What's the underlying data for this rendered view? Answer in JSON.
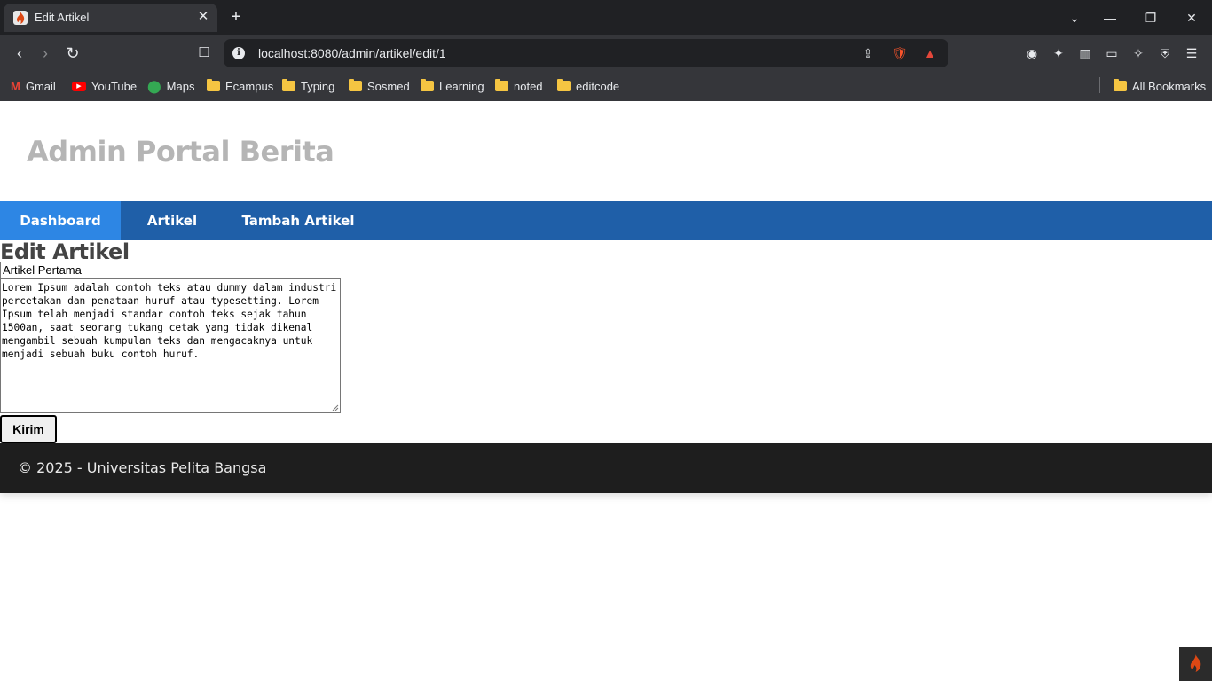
{
  "browser": {
    "tab_title": "Edit Artikel",
    "url": "localhost:8080/admin/artikel/edit/1",
    "bookmarks": [
      {
        "label": "Gmail",
        "icon": "gmail-icon"
      },
      {
        "label": "YouTube",
        "icon": "youtube-icon"
      },
      {
        "label": "Maps",
        "icon": "maps-icon"
      },
      {
        "label": "Ecampus",
        "icon": "folder-icon"
      },
      {
        "label": "Typing",
        "icon": "folder-icon"
      },
      {
        "label": "Sosmed",
        "icon": "folder-icon"
      },
      {
        "label": "Learning",
        "icon": "folder-icon"
      },
      {
        "label": "noted",
        "icon": "folder-icon"
      },
      {
        "label": "editcode",
        "icon": "folder-icon"
      }
    ],
    "all_bookmarks": "All Bookmarks"
  },
  "site": {
    "title": "Admin Portal Berita",
    "nav": [
      {
        "label": "Dashboard",
        "active": true
      },
      {
        "label": "Artikel",
        "active": false
      },
      {
        "label": "Tambah Artikel",
        "active": false
      }
    ],
    "colors": {
      "nav": "#1f5fa8",
      "nav_active": "#2d86e4",
      "footer": "#1e1e1e"
    }
  },
  "form": {
    "heading": "Edit Artikel",
    "title_value": "Artikel Pertama",
    "content_value": "Lorem Ipsum adalah contoh teks atau dummy dalam industri percetakan dan penataan huruf atau typesetting. Lorem Ipsum telah menjadi standar contoh teks sejak tahun 1500an, saat seorang tukang cetak yang tidak dikenal mengambil sebuah kumpulan teks dan mengacaknya untuk menjadi sebuah buku contoh huruf.",
    "submit_label": "Kirim"
  },
  "footer": {
    "text": "© 2025 - Universitas Pelita Bangsa"
  }
}
